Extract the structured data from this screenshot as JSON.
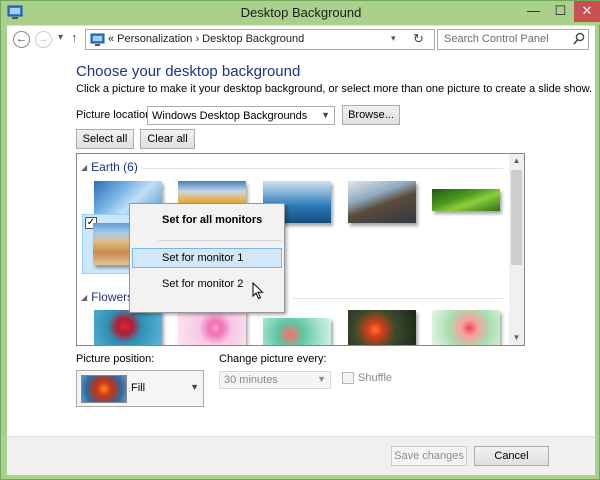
{
  "window": {
    "title": "Desktop Background",
    "minimize_glyph": "—",
    "maximize_glyph": "☐",
    "close_glyph": "✕"
  },
  "nav": {
    "back_glyph": "←",
    "forward_glyph": "→",
    "recent_glyph": "▾",
    "up_glyph": "↑",
    "breadcrumb": "«  Personalization  ›  Desktop Background",
    "refresh_glyph": "↻",
    "search_placeholder": "Search Control Panel"
  },
  "main": {
    "heading": "Choose your desktop background",
    "instructions": "Click a picture to make it your desktop background, or select more than one picture to create a slide show.",
    "picture_location_label": "Picture location:",
    "picture_location_value": "Windows Desktop Backgrounds",
    "browse_button": "Browse...",
    "select_all_button": "Select all",
    "clear_all_button": "Clear all"
  },
  "gallery": {
    "groups": [
      {
        "name": "Earth (6)"
      },
      {
        "name": "Flowers ("
      }
    ],
    "earth_thumbnails": [
      "wallpaper-blue-ice",
      "wallpaper-golden-dunes",
      "wallpaper-blue-lake",
      "wallpaper-rock-pier",
      "wallpaper-green-moss",
      "wallpaper-desert-dune"
    ],
    "flower_thumbnails": [
      "wallpaper-red-flower",
      "wallpaper-pink-flower",
      "wallpaper-blue-green-flower",
      "wallpaper-orange-flower",
      "wallpaper-pink-bloom"
    ],
    "selected_thumbnail_checked": true
  },
  "context_menu": {
    "items": [
      {
        "label": "Set for all monitors",
        "bold": true
      },
      {
        "label": "Set for monitor 1",
        "hover": true
      },
      {
        "label": "Set for monitor 2"
      }
    ]
  },
  "options": {
    "picture_position_label": "Picture position:",
    "picture_position_value": "Fill",
    "change_every_label": "Change picture every:",
    "change_every_value": "30 minutes",
    "shuffle_label": "Shuffle",
    "shuffle_checked": false
  },
  "footer": {
    "save_button": "Save changes",
    "cancel_button": "Cancel"
  },
  "colors": {
    "title_bar": "#a9d18c",
    "heading": "#1e3287",
    "close_button": "#c75050",
    "selection": "#cce8ff"
  }
}
